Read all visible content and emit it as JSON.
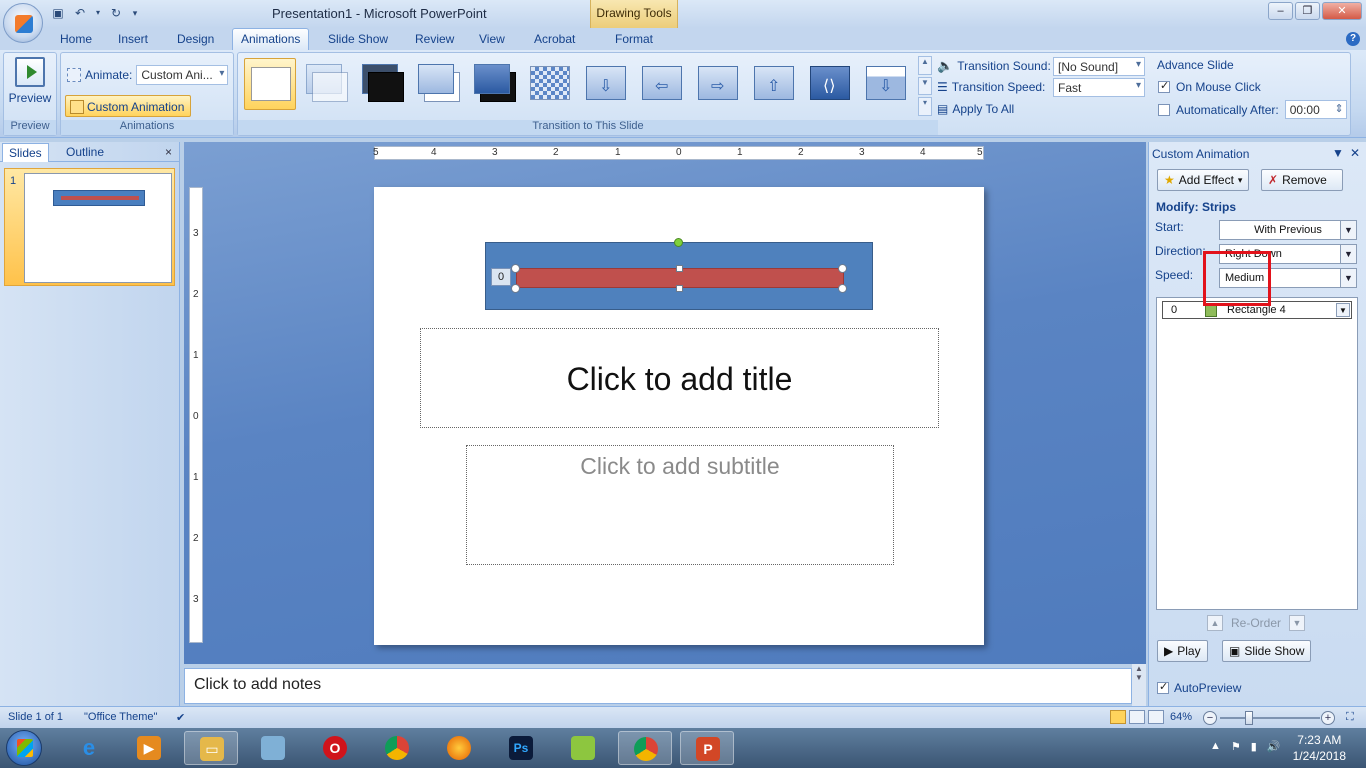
{
  "window": {
    "title": "Presentation1 - Microsoft PowerPoint",
    "context_tab_group": "Drawing Tools",
    "controls": [
      "–",
      "❐",
      "✕"
    ]
  },
  "ribbon_tabs": [
    "Home",
    "Insert",
    "Design",
    "Animations",
    "Slide Show",
    "Review",
    "View",
    "Acrobat",
    "Format"
  ],
  "active_tab": "Animations",
  "ribbon": {
    "preview": {
      "button_label": "Preview",
      "group_label": "Preview"
    },
    "animations": {
      "animate_label": "Animate:",
      "animate_value": "Custom Ani...",
      "custom_animation_label": "Custom Animation",
      "group_label": "Animations"
    },
    "transition": {
      "group_label": "Transition to This Slide",
      "sound_label": "Transition Sound:",
      "sound_value": "[No Sound]",
      "speed_label": "Transition Speed:",
      "speed_value": "Fast",
      "apply_all_label": "Apply To All"
    },
    "advance": {
      "title": "Advance Slide",
      "on_mouse_click_label": "On Mouse Click",
      "on_mouse_click_checked": true,
      "auto_after_label": "Automatically After:",
      "auto_after_checked": false,
      "auto_after_value": "00:00"
    }
  },
  "left_panel": {
    "tabs": [
      "Slides",
      "Outline"
    ],
    "close": "×",
    "slide_number": "1"
  },
  "ruler": {
    "horizontal": [
      "5",
      "4",
      "3",
      "2",
      "1",
      "0",
      "1",
      "2",
      "3",
      "4",
      "5"
    ],
    "vertical": [
      "3",
      "2",
      "1",
      "0",
      "1",
      "2",
      "3"
    ]
  },
  "slide": {
    "animation_tag": "0",
    "title_placeholder": "Click to add title",
    "subtitle_placeholder": "Click to add subtitle"
  },
  "notes_placeholder": "Click to add notes",
  "task_pane": {
    "title": "Custom Animation",
    "add_effect": "Add Effect",
    "remove": "Remove",
    "modify": "Modify: Strips",
    "start_label": "Start:",
    "start_value": "With Previous",
    "direction_label": "Direction:",
    "direction_value": "Right Down",
    "speed_label": "Speed:",
    "speed_value": "Medium",
    "list_item": {
      "num": "0",
      "name": "Rectangle 4"
    },
    "reorder_label": "Re-Order",
    "play": "Play",
    "slide_show": "Slide Show",
    "autopreview_label": "AutoPreview",
    "autopreview_checked": true
  },
  "status_bar": {
    "slide_info": "Slide 1 of 1",
    "theme": "\"Office Theme\"",
    "zoom": "64%",
    "zoom_level_percent": 64
  },
  "taskbar": {
    "apps": [
      "internet-explorer",
      "media-player",
      "file-explorer",
      "notes-app",
      "opera",
      "chrome",
      "firefox",
      "photoshop",
      "app-green",
      "chrome",
      "powerpoint"
    ],
    "time": "7:23 AM",
    "date": "1/24/2018"
  },
  "colors": {
    "highlight_box": "#e2121b",
    "shape_fill": "#4f81bd",
    "bar_fill": "#c0504d",
    "edit_background": "#5a84c3"
  }
}
